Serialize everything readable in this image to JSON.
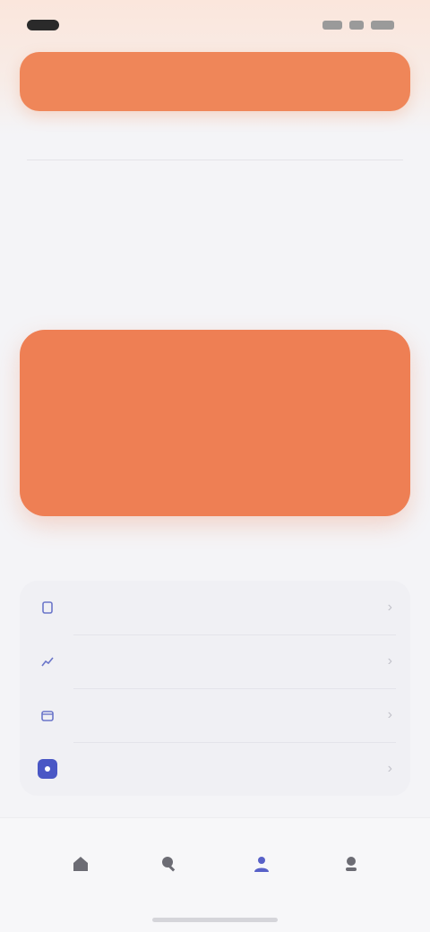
{
  "status_bar": {
    "time": "",
    "icons": [
      "signal-icon",
      "wifi-icon",
      "battery-icon"
    ]
  },
  "header": {
    "title": ""
  },
  "tabs": [
    {
      "label": "",
      "active": true
    },
    {
      "label": "",
      "active": false
    },
    {
      "label": "",
      "active": false
    },
    {
      "label": "",
      "active": false
    }
  ],
  "intro": {
    "title": "",
    "subtitle": ""
  },
  "hero": {
    "label": "",
    "value": ""
  },
  "section": {
    "title": ""
  },
  "list": {
    "items": [
      {
        "label": "",
        "icon": "document-icon"
      },
      {
        "label": "",
        "icon": "chart-icon"
      },
      {
        "label": "",
        "icon": "calendar-icon"
      },
      {
        "label": "",
        "icon": "settings-icon"
      }
    ]
  },
  "bottom_nav": {
    "items": [
      {
        "label": "",
        "icon": "home-icon"
      },
      {
        "label": "",
        "icon": "search-icon"
      },
      {
        "label": "",
        "icon": "profile-icon"
      },
      {
        "label": "",
        "icon": "menu-icon"
      }
    ],
    "active_index": 2
  },
  "colors": {
    "accent": "#EE7F54",
    "accent_dark": "#7A3212",
    "nav_active": "#5861C8",
    "list_icon": "#4A57C5",
    "background": "#F4F4F7"
  }
}
